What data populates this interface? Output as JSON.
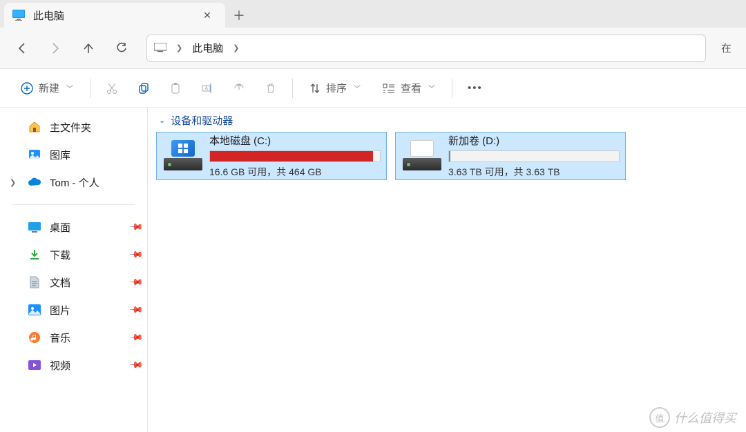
{
  "tab": {
    "title": "此电脑",
    "icon": "monitor-icon"
  },
  "breadcrumb": {
    "icon": "monitor-icon",
    "items": [
      "此电脑"
    ]
  },
  "search_truncated": "在",
  "cmd": {
    "new": "新建",
    "sort": "排序",
    "view": "查看"
  },
  "sidebar": {
    "top": [
      {
        "icon": "home-icon",
        "label": "主文件夹"
      },
      {
        "icon": "gallery-icon",
        "label": "图库"
      },
      {
        "icon": "onedrive-icon",
        "label": "Tom - 个人",
        "expandable": true
      }
    ],
    "pinned": [
      {
        "icon": "desktop-icon",
        "label": "桌面"
      },
      {
        "icon": "download-icon",
        "label": "下载"
      },
      {
        "icon": "document-icon",
        "label": "文档"
      },
      {
        "icon": "pictures-icon",
        "label": "图片"
      },
      {
        "icon": "music-icon",
        "label": "音乐"
      },
      {
        "icon": "video-icon",
        "label": "视频"
      }
    ]
  },
  "group_header": "设备和驱动器",
  "drives": [
    {
      "name": "本地磁盘 (C:)",
      "stat": "16.6 GB 可用，共 464 GB",
      "fill_pct": 96,
      "fill_color": "red",
      "os": true
    },
    {
      "name": "新加卷 (D:)",
      "stat": "3.63 TB 可用，共 3.63 TB",
      "fill_pct": 1,
      "fill_color": "blue",
      "os": false
    }
  ],
  "watermark": "什么值得买"
}
